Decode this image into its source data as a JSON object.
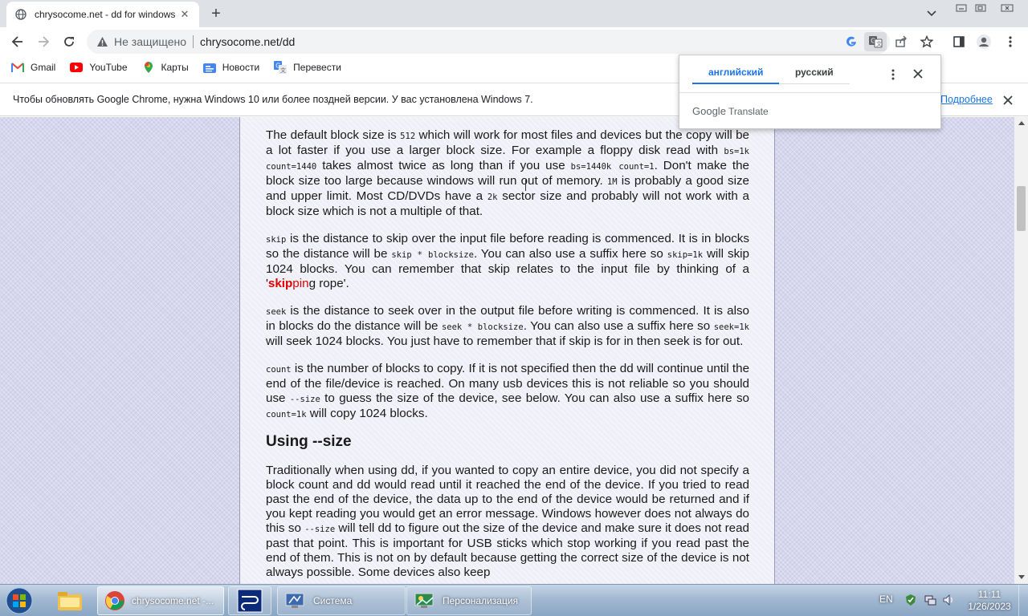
{
  "browser": {
    "tab_title": "chrysocome.net - dd for windows",
    "security_label": "Не защищено",
    "url": "chrysocome.net/dd"
  },
  "bookmarks": [
    {
      "label": "Gmail",
      "icon": "gmail-icon"
    },
    {
      "label": "YouTube",
      "icon": "youtube-icon"
    },
    {
      "label": "Карты",
      "icon": "maps-icon"
    },
    {
      "label": "Новости",
      "icon": "news-icon"
    },
    {
      "label": "Перевести",
      "icon": "translate-icon"
    }
  ],
  "infobar": {
    "text": "Чтобы обновлять Google Chrome, нужна Windows 10 или более поздней версии. У вас установлена Windows 7.",
    "link": "Подробнее"
  },
  "translate_popup": {
    "source_lang": "английский",
    "target_lang": "русский",
    "brand_google": "Google",
    "brand_translate": "Translate"
  },
  "article": {
    "p1": {
      "t1": "The default block size is ",
      "c1": "512",
      "t2": " which will work for most files and devices but the copy will be a lot faster if you use a larger block size. For example a floppy disk read with ",
      "c2": "bs=1k count=1440",
      "t3": " takes almost twice as long than if you use ",
      "c3": "bs=1440k count=1",
      "t4": ". Don't make the block size too large because windows will run out of memory. ",
      "c4": "1M",
      "t5": " is probably a good size and upper limit. Most CD/DVDs have a ",
      "c5": "2k",
      "t6": " sector size and probably will not work with a block size which is not a multiple of that."
    },
    "p2": {
      "c1": "skip",
      "t1": " is the distance to skip over the input file before reading is commenced. It is in blocks so the distance will be ",
      "c2": "skip * blocksize",
      "t2": ". You can also use a suffix here so ",
      "c3": "skip=1k",
      "t3": " will skip 1024 blocks. You can remember that skip relates to the input file by thinking of a '",
      "r1": "skip",
      "r2": "pin",
      "t4": "g rope'."
    },
    "p3": {
      "c1": "seek",
      "t1": " is the distance to seek over in the output file before writing is commenced. It is also in blocks do the distance will be ",
      "c2": "seek * blocksize",
      "t2": ". You can also use a suffix here so ",
      "c3": "seek=1k",
      "t3": " will seek 1024 blocks. You just have to remember that if skip is for in then seek is for out."
    },
    "p4": {
      "c1": "count",
      "t1": " is the number of blocks to copy. If it is not specified then the dd will continue until the end of the file/device is reached. On many usb devices this is not reliable so you should use ",
      "c2": "--size",
      "t2": " to guess the size of the device, see below. You can also use a suffix here so ",
      "c3": "count=1k",
      "t3": " will copy 1024 blocks."
    },
    "heading": "Using --size",
    "p5": {
      "t1": "Traditionally when using dd, if you wanted to copy an entire device, you did not specify a block count and dd would read until it reached the end of the device. If you tried to read past the end of the device, the data up to the end of the device would be returned and if you kept reading you would get an error message. Windows however does not always do this so ",
      "c1": "--size",
      "t2": " will tell dd to figure out the size of the device and make sure it does not read past that point. This is important for USB sticks which stop working if you read past the end of them. This is not on by default because getting the correct size of the device is not always possible. Some devices also keep"
    }
  },
  "taskbar": {
    "items": [
      {
        "label": "chrysocome.net -..."
      },
      {
        "label": "Система"
      },
      {
        "label": "Персонализация"
      }
    ],
    "lang": "EN",
    "time": "11:11",
    "date": "1/26/2023"
  },
  "colors": {
    "accent": "#1a73e8",
    "page_bg": "#d6d6ec",
    "content_bg": "#efeff7",
    "highlight_red": "#e00000"
  }
}
